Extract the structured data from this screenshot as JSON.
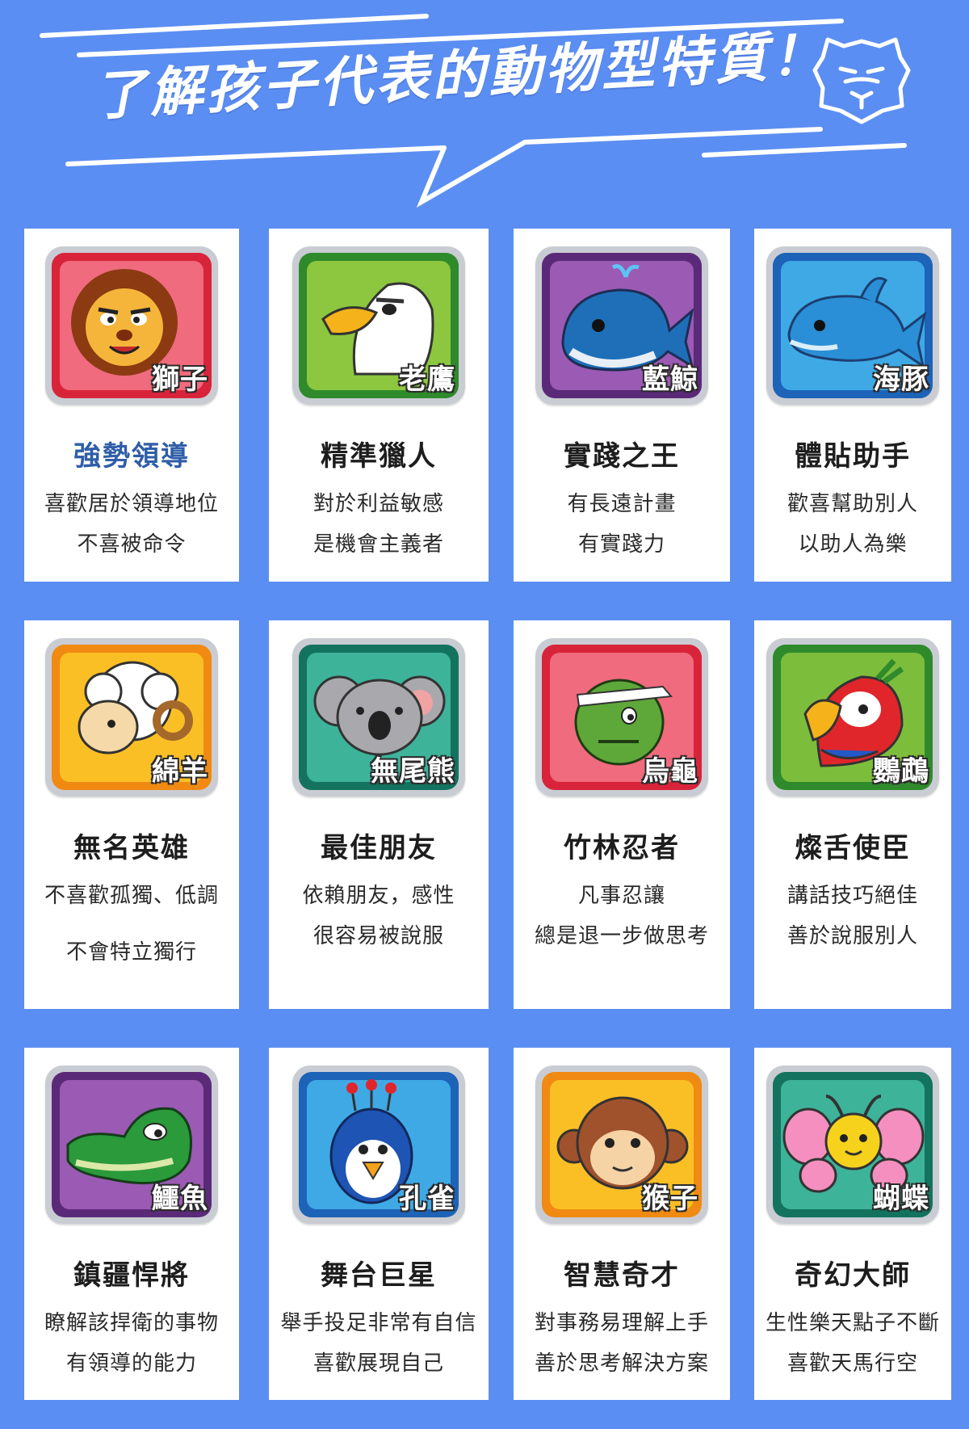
{
  "header": {
    "title": "了解孩子代表的動物型特質！",
    "logo_icon": "lion-outline-icon"
  },
  "colors": {
    "background": "#5b8ef2",
    "card": "#ffffff",
    "highlight_title": "#2f5ea8"
  },
  "cards": [
    {
      "animal": "獅子",
      "title": "強勢領導",
      "desc": [
        "喜歡居於領導地位",
        "不喜被命令"
      ],
      "bg": "#d8243a",
      "inner": "#ef6b7d",
      "icon": "lion-icon"
    },
    {
      "animal": "老鷹",
      "title": "精準獵人",
      "desc": [
        "對於利益敏感",
        "是機會主義者"
      ],
      "bg": "#2f8a2c",
      "inner": "#8dc63f",
      "icon": "eagle-icon"
    },
    {
      "animal": "藍鯨",
      "title": "實踐之王",
      "desc": [
        "有長遠計畫",
        "有實踐力"
      ],
      "bg": "#5a2a78",
      "inner": "#9b5ab3",
      "icon": "whale-icon"
    },
    {
      "animal": "海豚",
      "title": "體貼助手",
      "desc": [
        "歡喜幫助別人",
        "以助人為樂"
      ],
      "bg": "#1d63b8",
      "inner": "#3fa9e6",
      "icon": "dolphin-icon"
    },
    {
      "animal": "綿羊",
      "title": "無名英雄",
      "desc": [
        "不喜歡孤獨、低調",
        "不會特立獨行"
      ],
      "bg": "#f08a12",
      "inner": "#fbbf26",
      "icon": "sheep-icon"
    },
    {
      "animal": "無尾熊",
      "title": "最佳朋友",
      "desc": [
        "依賴朋友，感性",
        "很容易被說服"
      ],
      "bg": "#13735e",
      "inner": "#3db39a",
      "icon": "koala-icon"
    },
    {
      "animal": "烏龜",
      "title": "竹林忍者",
      "desc": [
        "凡事忍讓",
        "總是退一步做思考"
      ],
      "bg": "#d8243a",
      "inner": "#ef6b7d",
      "icon": "turtle-icon"
    },
    {
      "animal": "鸚鵡",
      "title": "燦舌使臣",
      "desc": [
        "講話技巧絕佳",
        "善於說服別人"
      ],
      "bg": "#2f8a2c",
      "inner": "#7dbd3c",
      "icon": "parrot-icon"
    },
    {
      "animal": "鱷魚",
      "title": "鎮疆悍將",
      "desc": [
        "瞭解該捍衛的事物",
        "有領導的能力"
      ],
      "bg": "#5a2a78",
      "inner": "#9b5ab3",
      "icon": "crocodile-icon"
    },
    {
      "animal": "孔雀",
      "title": "舞台巨星",
      "desc": [
        "舉手投足非常有自信",
        "喜歡展現自己"
      ],
      "bg": "#1d63b8",
      "inner": "#3fa9e6",
      "icon": "peacock-icon"
    },
    {
      "animal": "猴子",
      "title": "智慧奇才",
      "desc": [
        "對事務易理解上手",
        "善於思考解決方案"
      ],
      "bg": "#f08a12",
      "inner": "#fbbf26",
      "icon": "monkey-icon"
    },
    {
      "animal": "蝴蝶",
      "title": "奇幻大師",
      "desc": [
        "生性樂天點子不斷",
        "喜歡天馬行空"
      ],
      "bg": "#13735e",
      "inner": "#3db39a",
      "icon": "butterfly-icon"
    }
  ]
}
